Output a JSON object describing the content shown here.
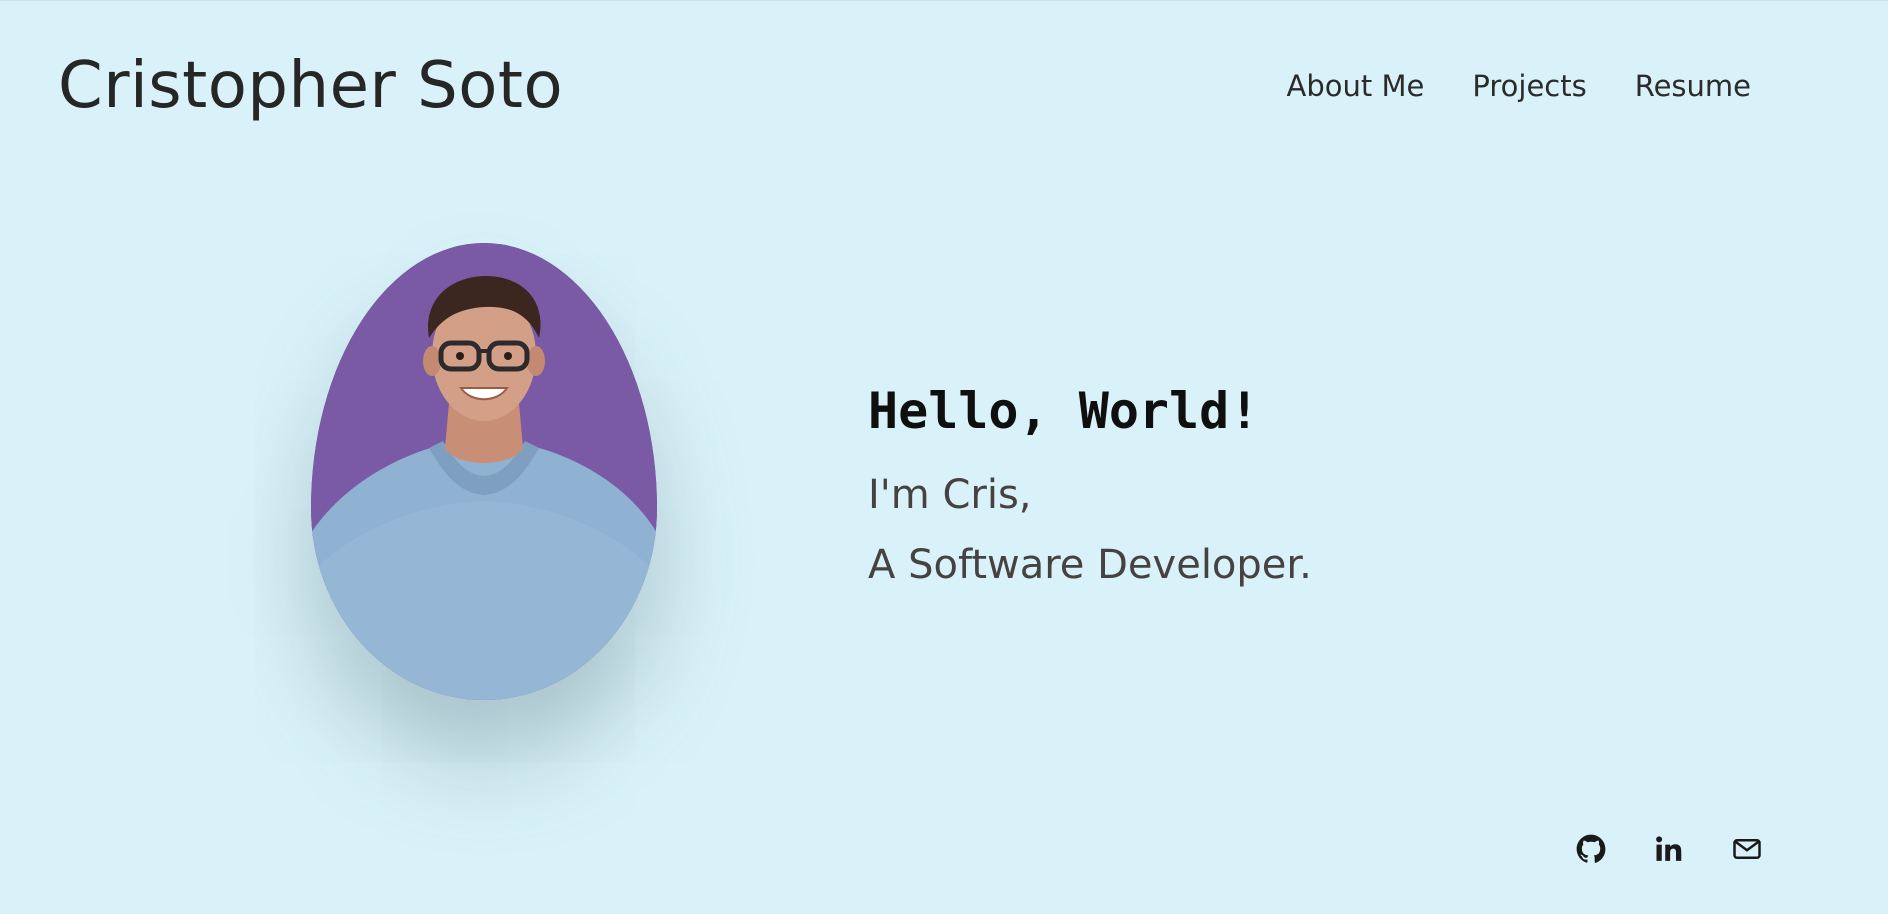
{
  "header": {
    "site_title": "Cristopher Soto",
    "nav": [
      {
        "label": "About Me"
      },
      {
        "label": "Projects"
      },
      {
        "label": "Resume"
      }
    ]
  },
  "hero": {
    "heading": "Hello, World!",
    "line1": "I'm Cris,",
    "line2": "A Software Developer."
  },
  "portrait": {
    "background_color": "#7a59a5"
  },
  "socials": [
    {
      "icon": "github-icon"
    },
    {
      "icon": "linkedin-icon"
    },
    {
      "icon": "email-icon"
    }
  ],
  "colors": {
    "page_background": "#d9f2f9",
    "text_dark": "#262626",
    "text_muted": "#474242"
  }
}
